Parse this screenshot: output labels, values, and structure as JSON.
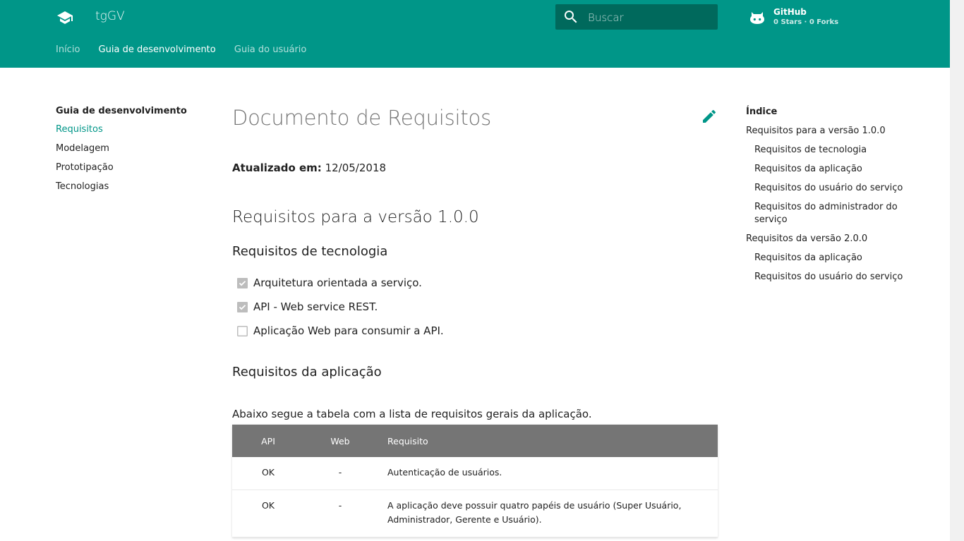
{
  "header": {
    "site_title": "tgGV",
    "search_placeholder": "Buscar",
    "github": {
      "name": "GitHub",
      "facts": "0 Stars · 0 Forks"
    },
    "tabs": [
      {
        "label": "Início",
        "active": false
      },
      {
        "label": "Guia de desenvolvimento",
        "active": true
      },
      {
        "label": "Guia do usuário",
        "active": false
      }
    ]
  },
  "sidebar": {
    "title": "Guia de desenvolvimento",
    "items": [
      {
        "label": "Requisitos",
        "active": true
      },
      {
        "label": "Modelagem",
        "active": false
      },
      {
        "label": "Prototipação",
        "active": false
      },
      {
        "label": "Tecnologias",
        "active": false
      }
    ]
  },
  "content": {
    "title": "Documento de Requisitos",
    "updated_label": "Atualizado em:",
    "updated_value": "12/05/2018",
    "section_title": "Requisitos para a versão 1.0.0",
    "tech_title": "Requisitos de tecnologia",
    "tasks": [
      {
        "label": "Arquitetura orientada a serviço.",
        "checked": true
      },
      {
        "label": "API - Web service REST.",
        "checked": true
      },
      {
        "label": "Aplicação Web para consumir a API.",
        "checked": false
      }
    ],
    "app_title": "Requisitos da aplicação",
    "intro": "Abaixo segue a tabela com a lista de requisitos gerais da aplicação.",
    "table": {
      "headers": [
        "API",
        "Web",
        "Requisito"
      ],
      "rows": [
        [
          "OK",
          "-",
          "Autenticação de usuários."
        ],
        [
          "OK",
          "-",
          "A aplicação deve possuir quatro papéis de usuário (Super Usuário, Administrador, Gerente e Usuário)."
        ]
      ]
    }
  },
  "toc": {
    "title": "Índice",
    "items": [
      {
        "label": "Requisitos para a versão 1.0.0",
        "level": 1
      },
      {
        "label": "Requisitos de tecnologia",
        "level": 2
      },
      {
        "label": "Requisitos da aplicação",
        "level": 2
      },
      {
        "label": "Requisitos do usuário do serviço",
        "level": 2
      },
      {
        "label": "Requisitos do administrador do serviço",
        "level": 2
      },
      {
        "label": "Requisitos da versão 2.0.0",
        "level": 1
      },
      {
        "label": "Requisitos da aplicação",
        "level": 2
      },
      {
        "label": "Requisitos do usuário do serviço",
        "level": 2
      }
    ]
  },
  "colors": {
    "primary": "#009688",
    "primary_dark": "#00695c",
    "table_header": "#757575"
  },
  "icons": [
    "school-icon",
    "search-icon",
    "github-icon",
    "edit-pencil-icon",
    "checkbox-checked-icon",
    "checkbox-empty-icon"
  ]
}
